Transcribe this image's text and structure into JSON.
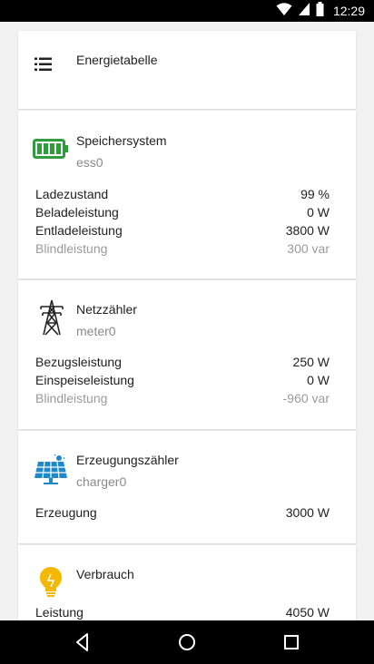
{
  "status_bar": {
    "time": "12:29"
  },
  "header": {
    "title": "Energietabelle",
    "menu_icon": "menu-icon"
  },
  "cards": {
    "storage": {
      "title": "Speichersystem",
      "subtitle": "ess0",
      "icon": "battery-icon",
      "icon_color": "#2e9e3a",
      "rows": [
        {
          "label": "Ladezustand",
          "value": "99 %"
        },
        {
          "label": "Beladeleistung",
          "value": "0 W"
        },
        {
          "label": "Entladeleistung",
          "value": "3800 W"
        },
        {
          "label": "Blindleistung",
          "value": "300 var"
        }
      ]
    },
    "meter": {
      "title": "Netzzähler",
      "subtitle": "meter0",
      "icon": "power-pylon-icon",
      "rows": [
        {
          "label": "Bezugsleistung",
          "value": "250 W"
        },
        {
          "label": "Einspeiseleistung",
          "value": "0 W"
        },
        {
          "label": "Blindleistung",
          "value": "-960 var"
        }
      ]
    },
    "production": {
      "title": "Erzeugungszähler",
      "subtitle": "charger0",
      "icon": "solar-panel-icon",
      "icon_color": "#1e88c8",
      "rows": [
        {
          "label": "Erzeugung",
          "value": "3000 W"
        }
      ]
    },
    "consumption": {
      "title": "Verbrauch",
      "icon": "lightbulb-icon",
      "icon_color": "#f5b800",
      "rows": [
        {
          "label": "Leistung",
          "value": "4050 W"
        }
      ]
    }
  },
  "nav_bar": {
    "back": "back-icon",
    "home": "home-icon",
    "recents": "recents-icon"
  }
}
